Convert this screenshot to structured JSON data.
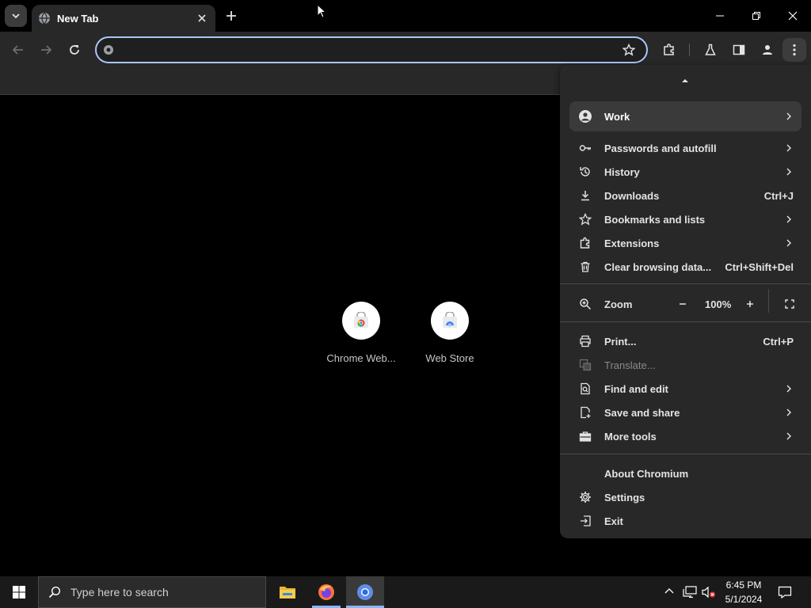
{
  "tabs": [
    {
      "title": "New Tab"
    }
  ],
  "omnibox": {
    "value": "",
    "placeholder": ""
  },
  "shortcuts": [
    {
      "label": "Chrome Web..."
    },
    {
      "label": "Web Store"
    }
  ],
  "menu": {
    "profile": {
      "label": "Work"
    },
    "items": {
      "passwords": {
        "label": "Passwords and autofill"
      },
      "history": {
        "label": "History"
      },
      "downloads": {
        "label": "Downloads",
        "shortcut": "Ctrl+J"
      },
      "bookmarks": {
        "label": "Bookmarks and lists"
      },
      "extensions": {
        "label": "Extensions"
      },
      "clear": {
        "label": "Clear browsing data...",
        "shortcut": "Ctrl+Shift+Del"
      }
    },
    "zoom": {
      "label": "Zoom",
      "value": "100%"
    },
    "items2": {
      "print": {
        "label": "Print...",
        "shortcut": "Ctrl+P"
      },
      "translate": {
        "label": "Translate..."
      },
      "find": {
        "label": "Find and edit"
      },
      "save": {
        "label": "Save and share"
      },
      "more": {
        "label": "More tools"
      }
    },
    "items3": {
      "about": {
        "label": "About Chromium"
      },
      "settings": {
        "label": "Settings"
      },
      "exit": {
        "label": "Exit"
      }
    }
  },
  "taskbar": {
    "search_placeholder": "Type here to search",
    "time": "6:45 PM",
    "date": "5/1/2024"
  },
  "colors": {
    "accent": "#a8c7fa",
    "menu_bg": "#282828",
    "toolbar_bg": "#282828",
    "page_bg": "#000000"
  }
}
